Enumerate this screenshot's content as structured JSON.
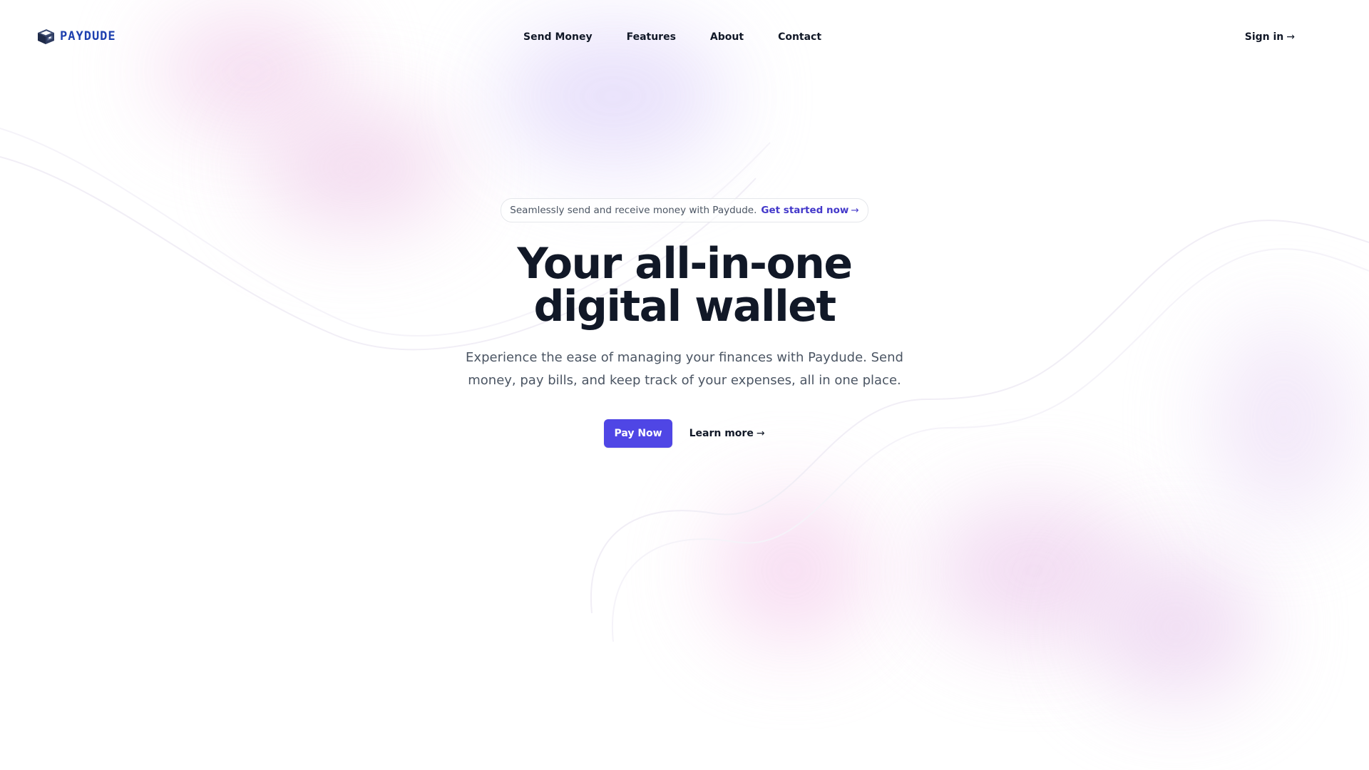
{
  "brand": {
    "name": "PAYDUDE",
    "color": "#1e40af"
  },
  "nav": {
    "items": [
      {
        "label": "Send Money"
      },
      {
        "label": "Features"
      },
      {
        "label": "About"
      },
      {
        "label": "Contact"
      }
    ],
    "signin_label": "Sign in",
    "signin_arrow": "→"
  },
  "hero": {
    "announcement": {
      "text": "Seamlessly send and receive money with Paydude.",
      "link_label": "Get started now",
      "link_arrow": "→"
    },
    "headline": "Your all-in-one digital wallet",
    "subtitle": "Experience the ease of managing your finances with Paydude. Send money, pay bills, and keep track of your expenses, all in one place.",
    "primary_button": "Pay Now",
    "secondary_link": "Learn more",
    "secondary_arrow": "→"
  },
  "colors": {
    "accent": "#4f46e5",
    "link": "#4338ca",
    "heading": "#111827",
    "body": "#4b5563"
  },
  "icons": {
    "logo": "wallet-cube-icon",
    "arrow": "arrow-right-icon"
  }
}
